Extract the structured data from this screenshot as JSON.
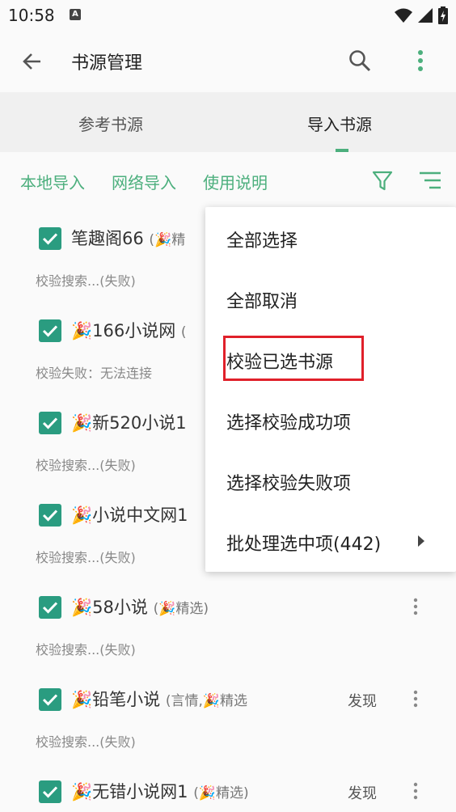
{
  "status_bar": {
    "time": "10:58",
    "notif_letter": "A"
  },
  "toolbar": {
    "title": "书源管理"
  },
  "tabs": [
    {
      "label": "参考书源"
    },
    {
      "label": "导入书源"
    }
  ],
  "actions": [
    {
      "label": "本地导入"
    },
    {
      "label": "网络导入"
    },
    {
      "label": "使用说明"
    }
  ],
  "items": [
    {
      "name": "笔趣阁66",
      "group": "(🎉精",
      "status": "校验搜索...(失败)",
      "discover": ""
    },
    {
      "name": "🎉166小说网",
      "group": "(",
      "status": "校验失败：无法连接",
      "discover": ""
    },
    {
      "name": "🎉新520小说1",
      "group": "",
      "status": "校验搜索...(失败)",
      "discover": ""
    },
    {
      "name": "🎉小说中文网1",
      "group": "",
      "status": "校验搜索...(失败)",
      "discover": ""
    },
    {
      "name": "🎉58小说",
      "group": "(🎉精选)",
      "status": "校验搜索...(失败)",
      "discover": ""
    },
    {
      "name": "🎉铅笔小说",
      "group": "(言情,🎉精选",
      "status": "校验搜索...(失败)",
      "discover": "发现"
    },
    {
      "name": "🎉无错小说网1",
      "group": "(🎉精选)",
      "status": "",
      "discover": "发现"
    }
  ],
  "menu": [
    {
      "label": "全部选择"
    },
    {
      "label": "全部取消"
    },
    {
      "label": "校验已选书源"
    },
    {
      "label": "选择校验成功项"
    },
    {
      "label": "选择校验失败项"
    },
    {
      "label": "批处理选中项(442)"
    }
  ],
  "colors": {
    "accent": "#4caf7d",
    "checkbox": "#2a9c80",
    "highlight": "#e0202a"
  }
}
